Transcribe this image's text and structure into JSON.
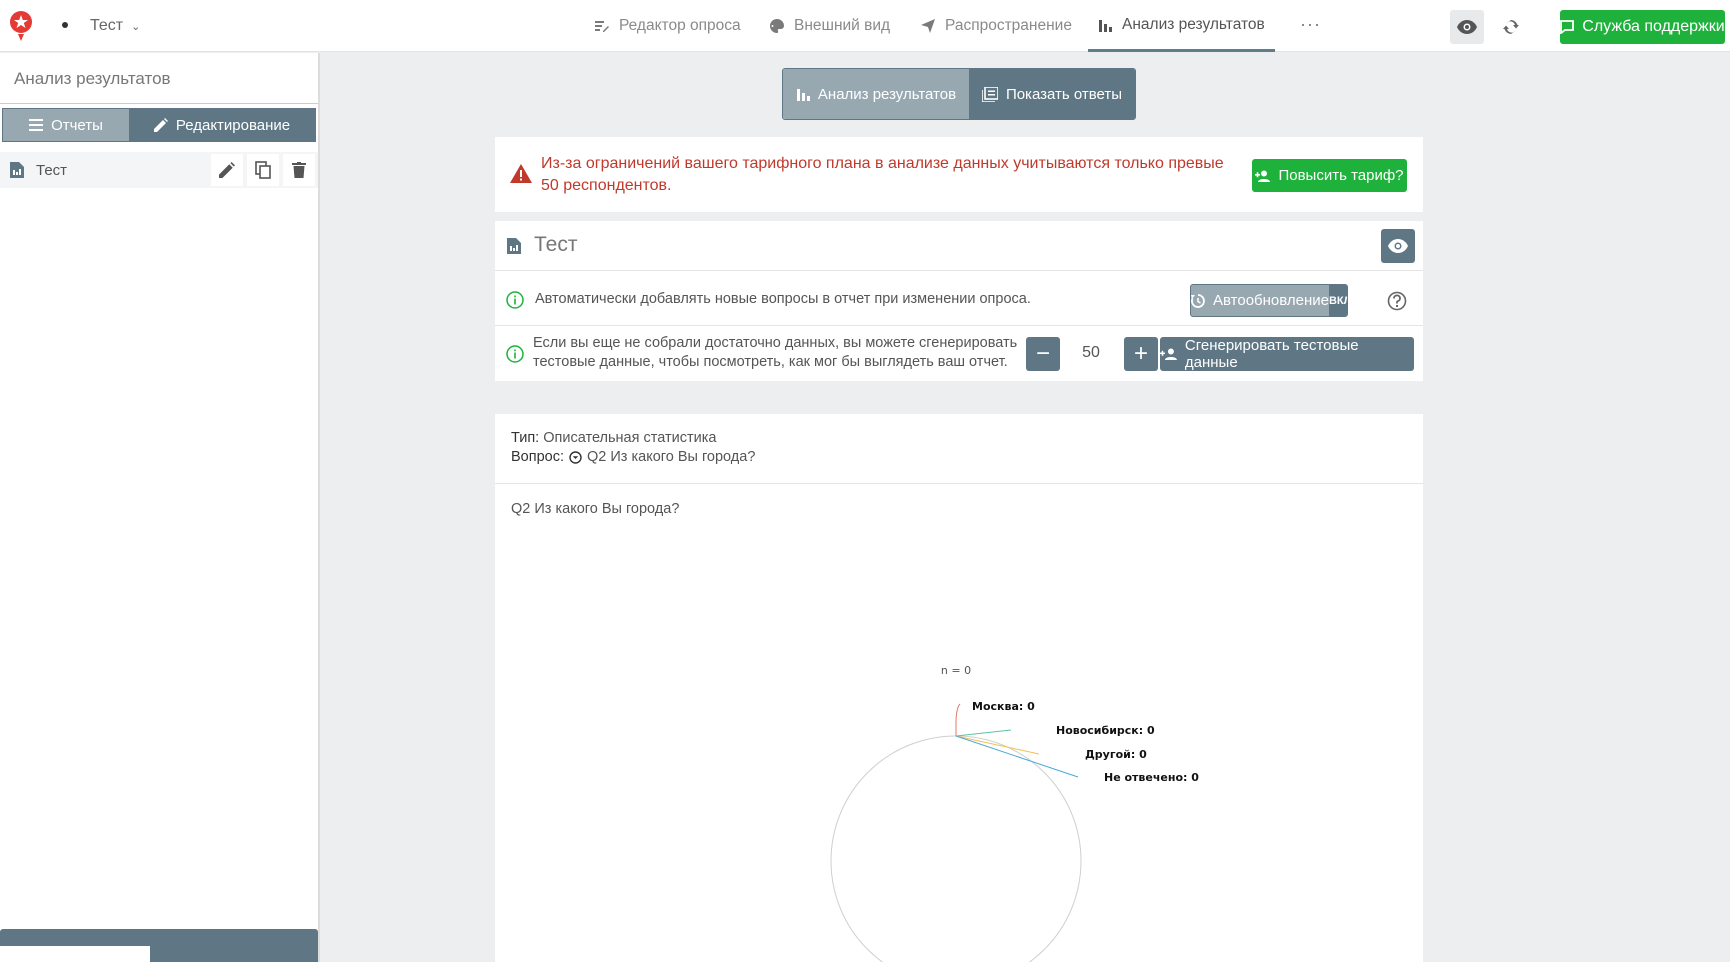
{
  "topbar": {
    "survey_name": "Тест",
    "nav": [
      {
        "label": "Редактор опроса"
      },
      {
        "label": "Внешний вид"
      },
      {
        "label": "Распространение"
      },
      {
        "label": "Анализ результатов",
        "active": true
      }
    ],
    "more_label": "···",
    "support_label": "Служба поддержки"
  },
  "sidebar": {
    "title": "Анализ результатов",
    "tabs": [
      {
        "label": "Отчеты",
        "active": true
      },
      {
        "label": "Редактирование"
      }
    ],
    "reports": [
      {
        "name": "Тест"
      }
    ]
  },
  "main": {
    "switch": [
      {
        "label": "Анализ результатов",
        "active": true
      },
      {
        "label": "Показать ответы"
      }
    ],
    "warning": {
      "text": "Из-за ограничений вашего тарифного плана в анализе данных учитываются только превые 50 респондентов.",
      "button": "Повысить тариф?"
    },
    "report": {
      "title": "Тест",
      "auto_text": "Автоматически добавлять новые вопросы в отчет при изменении опроса.",
      "auto_button": "Автообновление",
      "auto_state": "ВКЛ",
      "generate_text_1": "Если вы еще не собрали достаточно данных, вы можете сгенерировать",
      "generate_text_2": "тестовые данные, чтобы посмотреть, как мог бы выглядеть ваш отчет.",
      "generate_count": "50",
      "generate_button": "Сгенерировать тестовые данные"
    },
    "question": {
      "type_label": "Тип:",
      "type_value": "Описательная статистика",
      "question_label": "Вопрос:",
      "question_value": "Q2 Из какого Вы города?",
      "chart_title": "Q2 Из какого Вы города?"
    }
  },
  "colors": {
    "accent_green": "#1eb23c",
    "slate": "#5f7684",
    "slate_light": "#98a8b1",
    "warning_red": "#c0392b"
  },
  "chart_data": {
    "type": "pie",
    "n_label": "n = 0",
    "categories": [
      "Москва",
      "Новосибирск",
      "Другой",
      "Не отвечено"
    ],
    "values": [
      0,
      0,
      0,
      0
    ],
    "labels": [
      "Москва: 0",
      "Новосибирск: 0",
      "Другой: 0",
      "Не отвечено: 0"
    ],
    "colors": [
      "#e07a6a",
      "#5fc3a0",
      "#f2c14e",
      "#4aa8d8"
    ]
  }
}
